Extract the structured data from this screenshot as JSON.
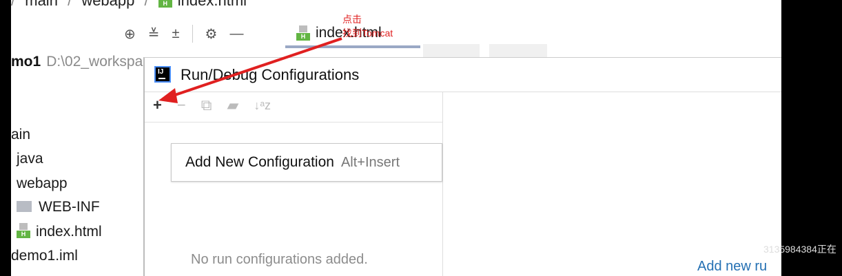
{
  "breadcrumb": {
    "part1": "main",
    "part2": "webapp",
    "part3": "index.html",
    "sep": "/"
  },
  "toolbar": {
    "target_icon": "⊕",
    "collapse_icon": "≚",
    "expand_icon": "±",
    "gear_icon": "⚙",
    "minus_icon": "—"
  },
  "editor_tab": {
    "label": "index.html"
  },
  "project": {
    "root_name": "mo1",
    "root_path": "D:\\02_workspa",
    "items": [
      {
        "label": "ain"
      },
      {
        "label": "java"
      },
      {
        "label": "webapp"
      },
      {
        "label": "WEB-INF"
      },
      {
        "label": "index.html"
      },
      {
        "label": "demo1.iml"
      }
    ]
  },
  "dialog": {
    "title": "Run/Debug Configurations",
    "toolbar": {
      "add": "+",
      "remove": "−",
      "copy": "⧉",
      "folder": "▰",
      "sort": "↓ᵃz"
    },
    "popup": {
      "label": "Add New Configuration",
      "shortcut": "Alt+Insert"
    },
    "empty_text": "No run configurations added.",
    "add_new_link": "Add new ru"
  },
  "annotation": {
    "line1": "点击",
    "line2": "找到Tomcat"
  },
  "watermark": "3135984384正在",
  "colors": {
    "accent_link": "#2470b3",
    "annotation_red": "#e02020",
    "html_icon_green": "#62b543"
  }
}
